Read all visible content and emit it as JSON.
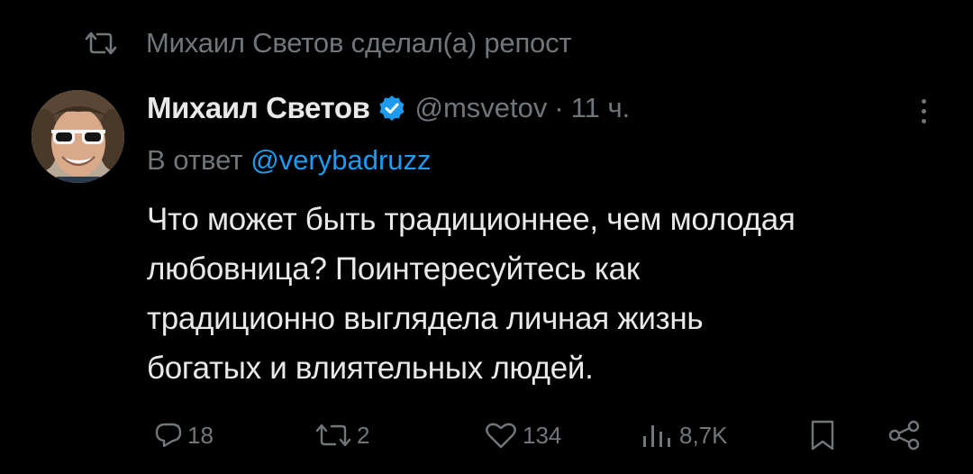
{
  "repost": {
    "text": "Михаил Светов сделал(а) репост",
    "icon": "repost-icon"
  },
  "author": {
    "name": "Михаил Светов",
    "handle": "@msvetov",
    "separator": "·",
    "time": "11 ч.",
    "verified": true,
    "avatar_icon": "avatar"
  },
  "reply": {
    "prefix": "В ответ",
    "handle": "@verybadruzz"
  },
  "tweet": {
    "lines": [
      "Что может быть традиционнее, чем молодая",
      "любовница? Поинтересуйтесь как",
      "традиционно выглядела личная жизнь",
      "богатых и влиятельных людей."
    ]
  },
  "actions": {
    "replies": "18",
    "reposts": "2",
    "likes": "134",
    "views": "8,7K"
  },
  "colors": {
    "background": "#000000",
    "text": "#e7e9ea",
    "muted": "#71767b",
    "accent": "#1d9bf0"
  }
}
